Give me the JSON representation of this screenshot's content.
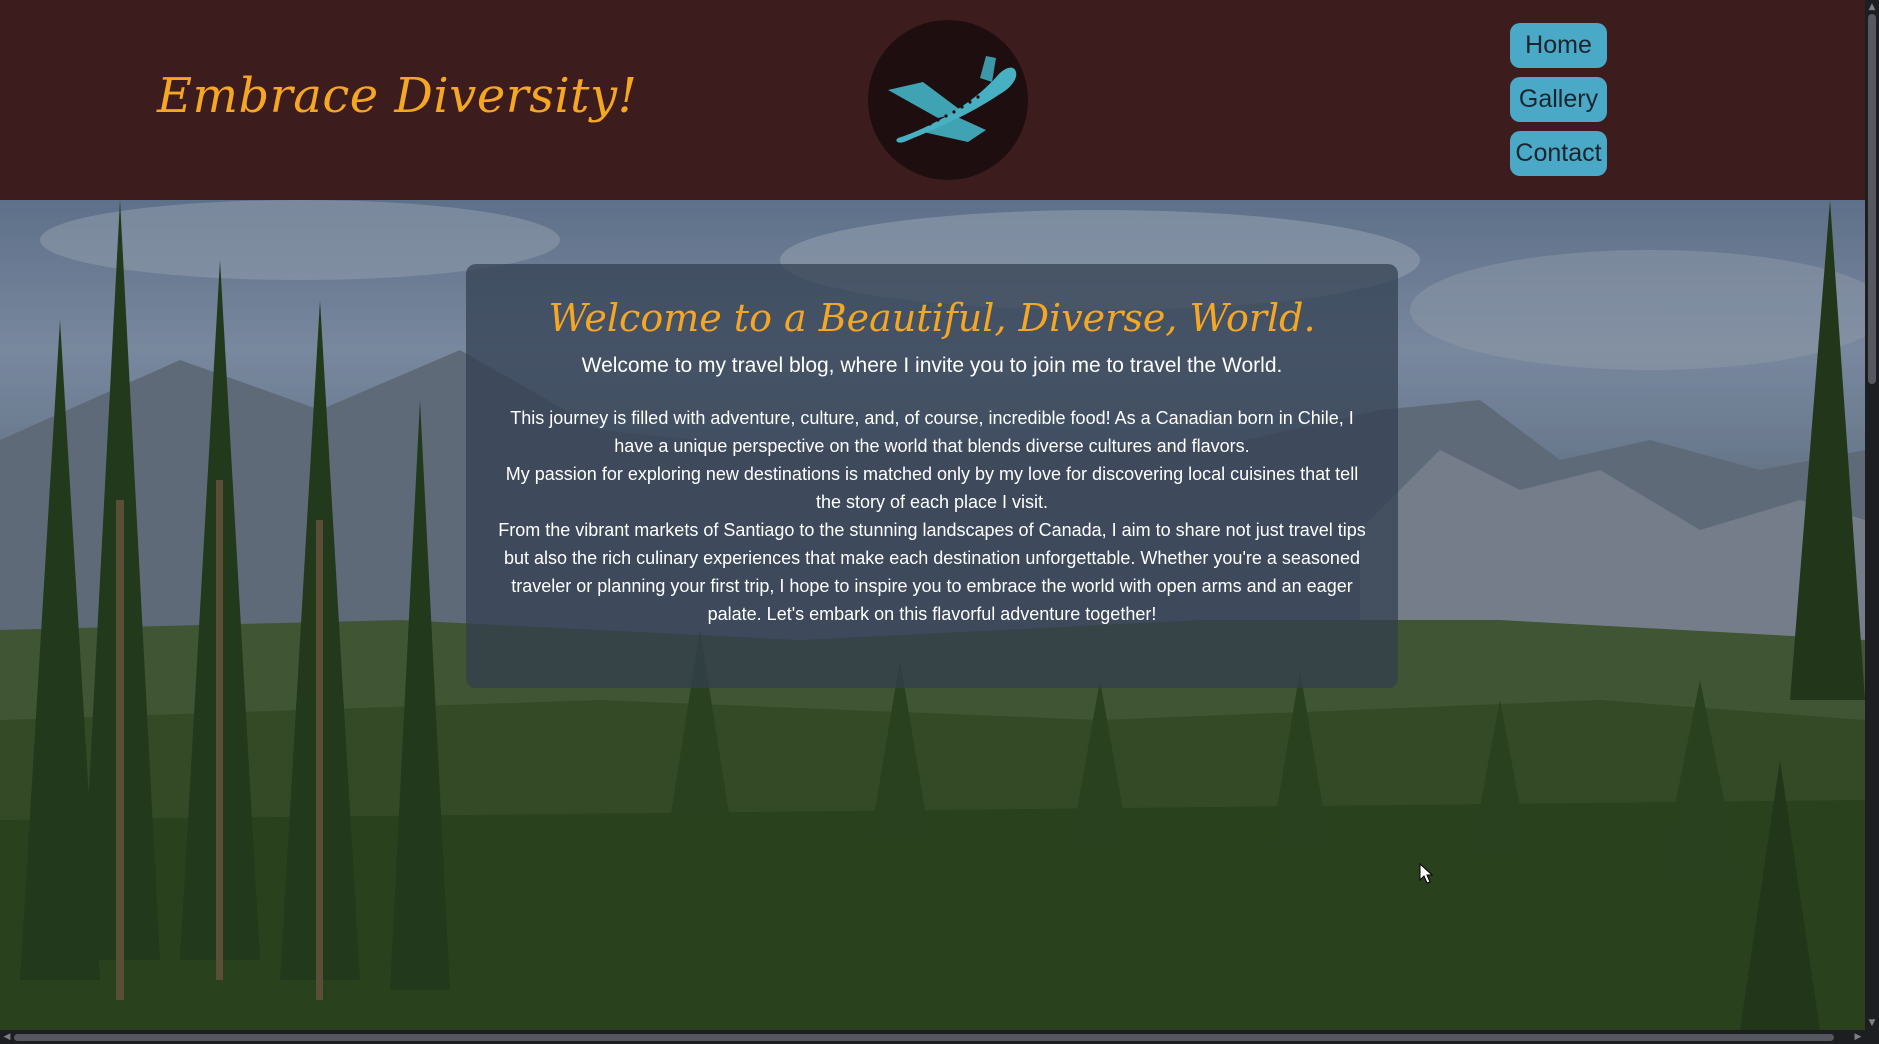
{
  "header": {
    "site_title": "Embrace Diversity!",
    "logo_icon": "airplane-icon",
    "nav": [
      {
        "label": "Home"
      },
      {
        "label": "Gallery"
      },
      {
        "label": "Contact"
      }
    ]
  },
  "main": {
    "heading": "Welcome to a Beautiful, Diverse, World.",
    "intro": "Welcome to my travel blog, where I invite you to join me to travel the World.",
    "paragraphs": [
      "This journey is filled with adventure, culture, and, of course, incredible food! As a Canadian born in Chile, I have a unique perspective on the world that blends diverse cultures and flavors.",
      "My passion for exploring new destinations is matched only by my love for discovering local cuisines that tell the story of each place I visit.",
      "From the vibrant markets of Santiago to the stunning landscapes of Canada, I aim to share not just travel tips but also the rich culinary experiences that make each destination unforgettable. Whether you're a seasoned traveler or planning your first trip, I hope to inspire you to embrace the world with open arms and an eager palate. Let's embark on this flavorful adventure together!"
    ],
    "background_image": "forest-mountain-landscape"
  },
  "colors": {
    "header_bg": "#3d1c1e",
    "accent": "#f5a623",
    "nav_button": "#4aa9c6",
    "card_bg": "rgba(50, 62, 80, 0.72)"
  }
}
